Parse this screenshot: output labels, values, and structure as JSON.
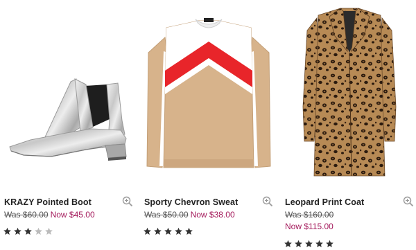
{
  "products": [
    {
      "name": "KRAZY Pointed Boot",
      "was_price": "Was $60.00",
      "now_price": "Now $45.00",
      "rating": 3,
      "rating_max": 5
    },
    {
      "name": "Sporty Chevron Sweat",
      "was_price": "Was $50.00",
      "now_price": "Now $38.00",
      "rating": 5,
      "rating_max": 5
    },
    {
      "name": "Leopard Print Coat",
      "was_price": "Was $160.00",
      "now_price": "Now $115.00",
      "rating": 5,
      "rating_max": 5
    }
  ],
  "colors": {
    "now_price": "#a3185a",
    "star_filled": "#333333",
    "star_empty": "#bbbbbb",
    "sweater_red": "#e8252a",
    "sweater_tan": "#d7b38b"
  },
  "icons": {
    "zoom": "magnifier-plus-icon",
    "star": "star-icon"
  }
}
